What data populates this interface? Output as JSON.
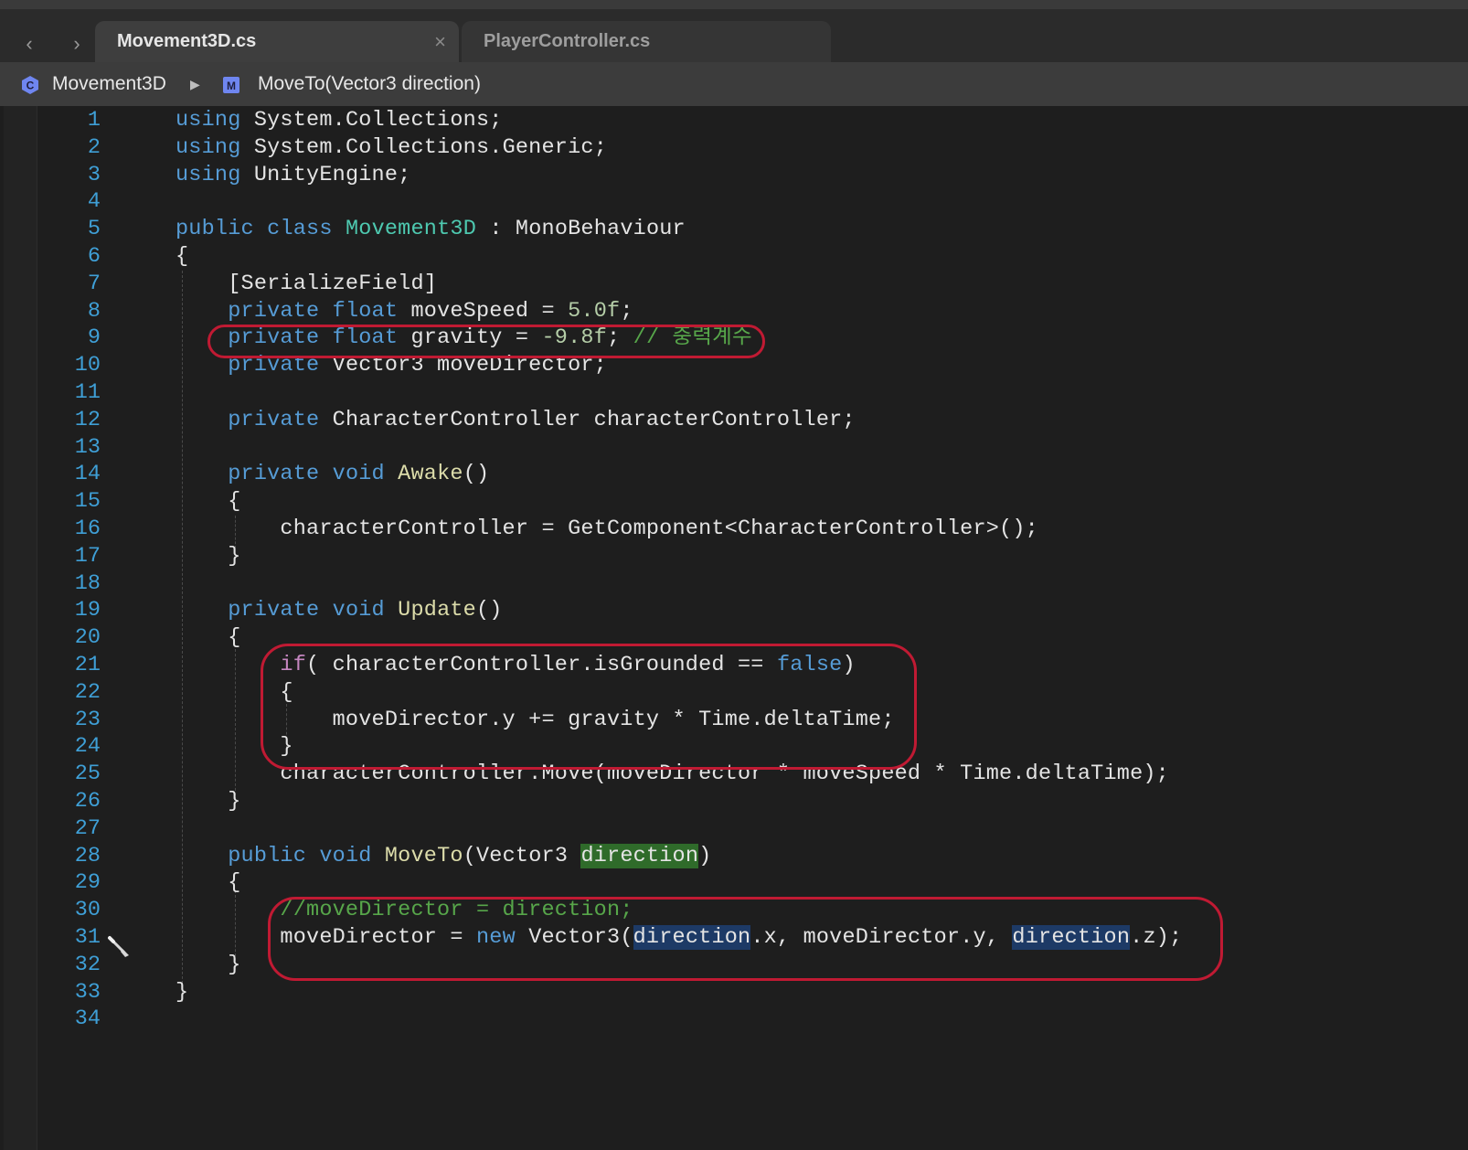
{
  "tabs": [
    {
      "label": "Movement3D.cs",
      "active": true,
      "close_glyph": "×"
    },
    {
      "label": "PlayerController.cs",
      "active": false
    }
  ],
  "nav": {
    "back_glyph": "‹",
    "forward_glyph": "›"
  },
  "breadcrumb": {
    "class_name": "Movement3D",
    "separator": "▶",
    "method_name": "MoveTo(Vector3 direction)",
    "class_icon": "class-icon",
    "method_icon": "method-icon"
  },
  "editor": {
    "lines": [
      {
        "n": "1",
        "tokens": [
          [
            "kw",
            "using"
          ],
          [
            "",
            "System.Collections;"
          ]
        ]
      },
      {
        "n": "2",
        "tokens": [
          [
            "kw",
            "using"
          ],
          [
            "",
            "System.Collections.Generic;"
          ]
        ]
      },
      {
        "n": "3",
        "tokens": [
          [
            "kw",
            "using"
          ],
          [
            "",
            "UnityEngine;"
          ]
        ]
      },
      {
        "n": "4",
        "tokens": []
      },
      {
        "n": "5",
        "tokens": [
          [
            "kw",
            "public"
          ],
          [
            "kw",
            "class"
          ],
          [
            "ty",
            "Movement3D"
          ],
          [
            "",
            ": MonoBehaviour"
          ]
        ]
      },
      {
        "n": "6",
        "tokens": [
          [
            "",
            "{"
          ]
        ]
      },
      {
        "n": "7",
        "tokens": [
          [
            "",
            "    [SerializeField]"
          ]
        ]
      },
      {
        "n": "8",
        "tokens": [
          [
            "kw",
            "    private"
          ],
          [
            "kw",
            "float"
          ],
          [
            "",
            "moveSpeed ="
          ],
          [
            "num",
            "5.0f"
          ],
          [
            "",
            ";"
          ]
        ]
      },
      {
        "n": "9",
        "tokens": [
          [
            "kw",
            "    private"
          ],
          [
            "kw",
            "float"
          ],
          [
            "",
            "gravity = "
          ],
          [
            "num",
            "-9.8f"
          ],
          [
            "",
            ";"
          ],
          [
            "cm",
            "// 충력계수"
          ]
        ]
      },
      {
        "n": "10",
        "tokens": [
          [
            "kw",
            "    private"
          ],
          [
            "",
            "Vector3 moveDirector;"
          ]
        ]
      },
      {
        "n": "11",
        "tokens": []
      },
      {
        "n": "12",
        "tokens": [
          [
            "kw",
            "    private"
          ],
          [
            "",
            "CharacterController characterController;"
          ]
        ]
      },
      {
        "n": "13",
        "tokens": []
      },
      {
        "n": "14",
        "tokens": [
          [
            "kw",
            "    private"
          ],
          [
            "kw",
            "void"
          ],
          [
            "fn",
            "Awake"
          ],
          [
            "",
            "()"
          ]
        ]
      },
      {
        "n": "15",
        "tokens": [
          [
            "",
            "    {"
          ]
        ]
      },
      {
        "n": "16",
        "tokens": [
          [
            "",
            "        characterController = GetComponent<CharacterController>();"
          ]
        ]
      },
      {
        "n": "17",
        "tokens": [
          [
            "",
            "    }"
          ]
        ]
      },
      {
        "n": "18",
        "tokens": []
      },
      {
        "n": "19",
        "tokens": [
          [
            "kw",
            "    private"
          ],
          [
            "kw",
            "void"
          ],
          [
            "fn",
            "Update"
          ],
          [
            "",
            "()"
          ]
        ]
      },
      {
        "n": "20",
        "tokens": [
          [
            "",
            "    {"
          ]
        ]
      },
      {
        "n": "21",
        "tokens": [
          [
            "kw2",
            "        if"
          ],
          [
            "",
            "( characterController.isGrounded =="
          ],
          [
            "kw",
            "false"
          ],
          [
            "",
            ")"
          ]
        ]
      },
      {
        "n": "22",
        "tokens": [
          [
            "",
            "        {"
          ]
        ]
      },
      {
        "n": "23",
        "tokens": [
          [
            "",
            "            moveDirector.y += gravity * Time.deltaTime;"
          ]
        ]
      },
      {
        "n": "24",
        "tokens": [
          [
            "",
            "        }"
          ]
        ]
      },
      {
        "n": "25",
        "tokens": [
          [
            "",
            "        characterController.Move(moveDirector * moveSpeed * Time.deltaTime);"
          ]
        ]
      },
      {
        "n": "26",
        "tokens": [
          [
            "",
            "    }"
          ]
        ]
      },
      {
        "n": "27",
        "tokens": []
      },
      {
        "n": "28",
        "tokens": [
          [
            "kw",
            "    public"
          ],
          [
            "kw",
            "void"
          ],
          [
            "fn",
            "MoveTo"
          ],
          [
            "",
            "(Vector3 "
          ],
          [
            "hl-def",
            "direction"
          ],
          [
            "",
            ")"
          ]
        ]
      },
      {
        "n": "29",
        "tokens": [
          [
            "",
            "    {"
          ]
        ]
      },
      {
        "n": "30",
        "tokens": [
          [
            "cm",
            "        //moveDirector = direction;"
          ]
        ]
      },
      {
        "n": "31",
        "tokens": [
          [
            "",
            "        moveDirector ="
          ],
          [
            "kw",
            "new"
          ],
          [
            "",
            "Vector3("
          ],
          [
            "hl-ref",
            "direction"
          ],
          [
            "",
            ".x, moveDirector.y, "
          ],
          [
            "hl-ref",
            "direction"
          ],
          [
            "",
            ".z);"
          ]
        ]
      },
      {
        "n": "32",
        "tokens": [
          [
            "",
            "    }"
          ]
        ]
      },
      {
        "n": "33",
        "tokens": [
          [
            "",
            "}"
          ]
        ]
      },
      {
        "n": "34",
        "tokens": []
      }
    ]
  },
  "colors": {
    "keyword": "#569cd6",
    "control": "#c586c0",
    "type": "#4ec9b0",
    "function": "#dcdcaa",
    "number": "#b5cea8",
    "comment": "#57a64a",
    "callout": "#c01a33",
    "line_number": "#3f9fd6"
  },
  "gutter_glyph_icon": "pencil-edit-icon"
}
